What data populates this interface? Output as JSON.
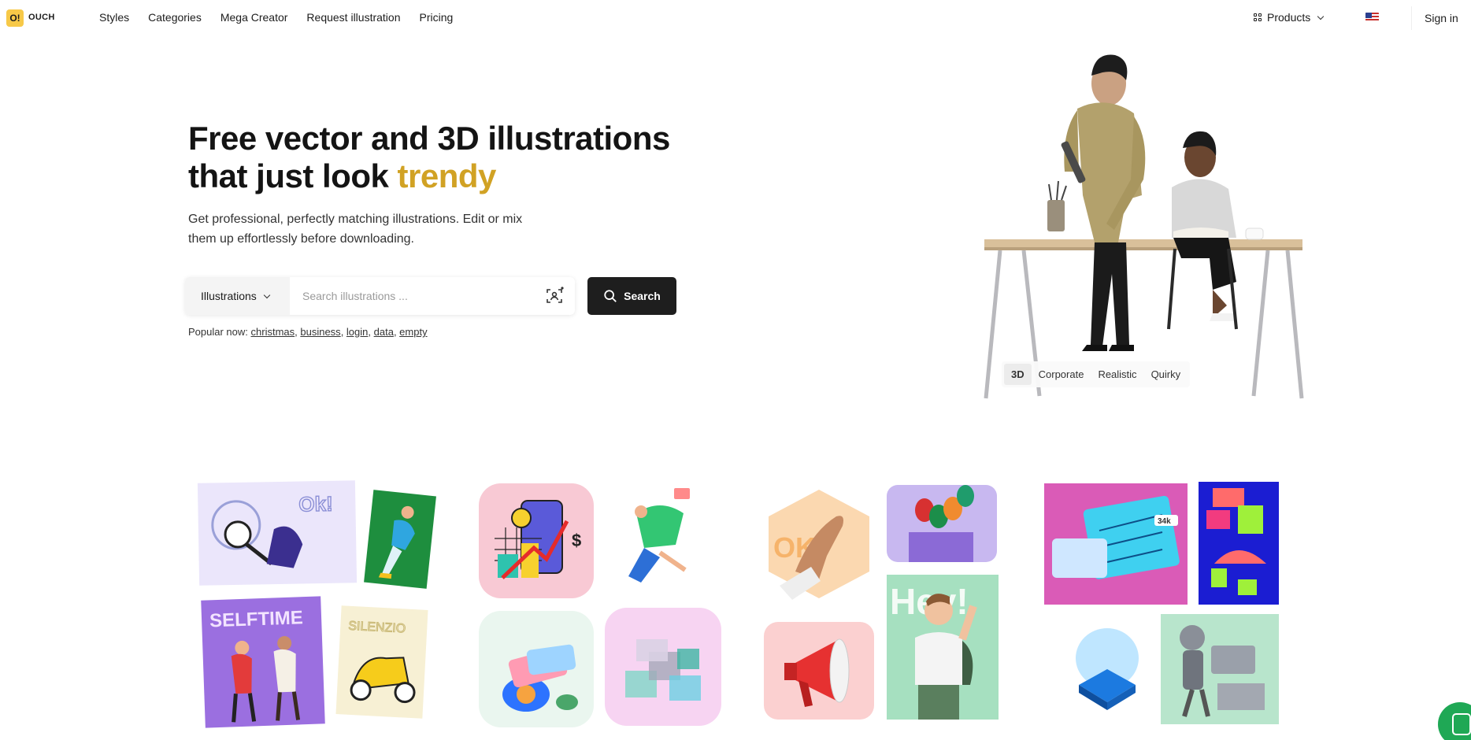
{
  "brand": {
    "logo_mark": "O!",
    "name": "OUCH"
  },
  "nav": {
    "items": [
      "Styles",
      "Categories",
      "Mega Creator",
      "Request illustration",
      "Pricing"
    ],
    "products_label": "Products",
    "signin_label": "Sign in"
  },
  "hero": {
    "title_line1": "Free vector and 3D illustrations",
    "title_line2_prefix": "that just look ",
    "title_accent": "trendy",
    "subtitle": "Get professional, perfectly matching illustrations. Edit or mix them up effortlessly before downloading.",
    "search": {
      "type_selected": "Illustrations",
      "placeholder": "Search illustrations ...",
      "button_label": "Search"
    },
    "popular": {
      "prefix": "Popular now:",
      "terms": [
        "christmas",
        "business",
        "login",
        "data",
        "empty"
      ]
    },
    "style_tabs": [
      "3D",
      "Corporate",
      "Realistic",
      "Quirky"
    ],
    "active_style": "3D"
  },
  "gallery": {
    "tile_texts": {
      "ok": "Ok!",
      "selftime": "SELFTIME",
      "silenzio": "SILENZIO",
      "hey": "Hey!",
      "oks": "OK",
      "dollar": "$",
      "stat": "34k"
    }
  },
  "colors": {
    "accent": "#d1a224",
    "button": "#1e1e1e",
    "chat": "#1fa855"
  }
}
